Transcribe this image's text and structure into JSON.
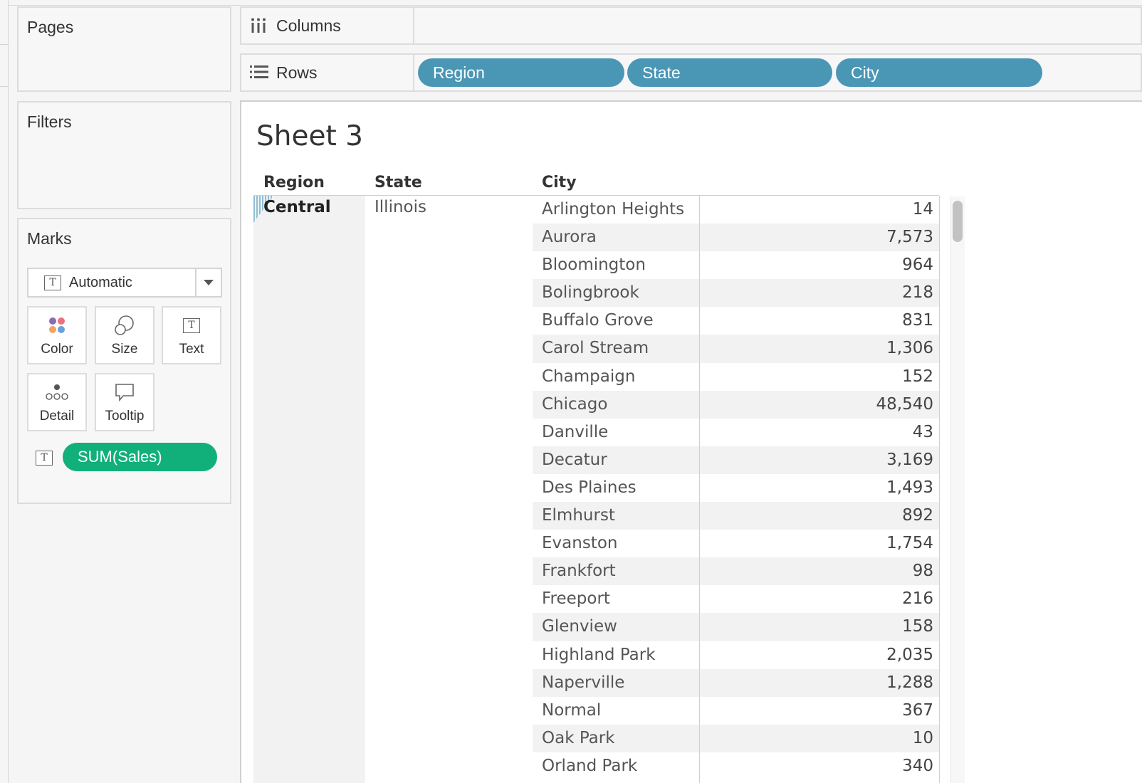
{
  "cards": {
    "pages_title": "Pages",
    "filters_title": "Filters",
    "marks_title": "Marks"
  },
  "marks": {
    "type_label": "Automatic",
    "buttons": {
      "color": "Color",
      "size": "Size",
      "text": "Text",
      "detail": "Detail",
      "tooltip": "Tooltip"
    },
    "measure_pill": "SUM(Sales)",
    "icon_letter": "T",
    "colors": {
      "measure_pill": "#11b07a",
      "dimension_pill": "#4a96b5"
    }
  },
  "shelves": {
    "columns_label": "Columns",
    "rows_label": "Rows",
    "row_pills": [
      "Region",
      "State",
      "City"
    ]
  },
  "view": {
    "sheet_title": "Sheet 3",
    "headers": {
      "region": "Region",
      "state": "State",
      "city": "City"
    },
    "region": "Central",
    "state": "Illinois",
    "rows": [
      {
        "city": "Arlington Heights",
        "value": "14"
      },
      {
        "city": "Aurora",
        "value": "7,573"
      },
      {
        "city": "Bloomington",
        "value": "964"
      },
      {
        "city": "Bolingbrook",
        "value": "218"
      },
      {
        "city": "Buffalo Grove",
        "value": "831"
      },
      {
        "city": "Carol Stream",
        "value": "1,306"
      },
      {
        "city": "Champaign",
        "value": "152"
      },
      {
        "city": "Chicago",
        "value": "48,540"
      },
      {
        "city": "Danville",
        "value": "43"
      },
      {
        "city": "Decatur",
        "value": "3,169"
      },
      {
        "city": "Des Plaines",
        "value": "1,493"
      },
      {
        "city": "Elmhurst",
        "value": "892"
      },
      {
        "city": "Evanston",
        "value": "1,754"
      },
      {
        "city": "Frankfort",
        "value": "98"
      },
      {
        "city": "Freeport",
        "value": "216"
      },
      {
        "city": "Glenview",
        "value": "158"
      },
      {
        "city": "Highland Park",
        "value": "2,035"
      },
      {
        "city": "Naperville",
        "value": "1,288"
      },
      {
        "city": "Normal",
        "value": "367"
      },
      {
        "city": "Oak Park",
        "value": "10"
      },
      {
        "city": "Orland Park",
        "value": "340"
      }
    ]
  }
}
